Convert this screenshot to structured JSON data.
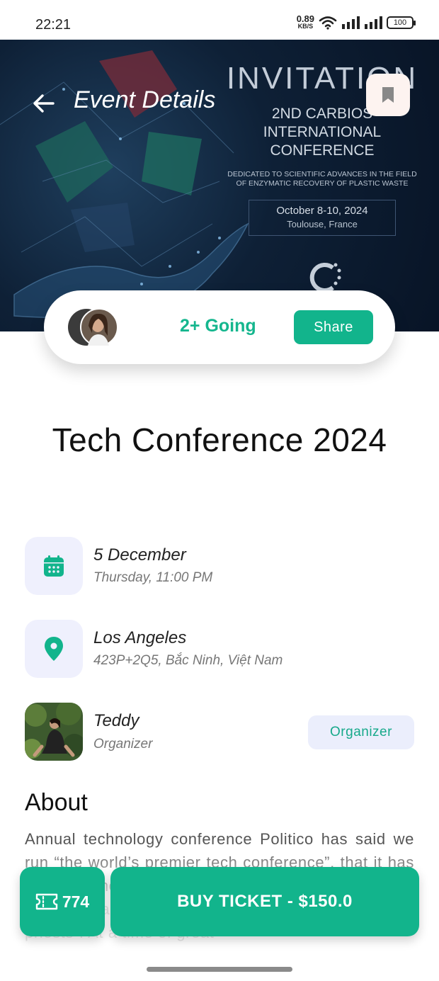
{
  "status_bar": {
    "time": "22:21",
    "net_speed": "0.89",
    "net_unit": "KB/S",
    "battery": "100"
  },
  "header": {
    "title": "Event Details",
    "back_icon": "arrow-left-icon",
    "bookmark_icon": "bookmark-icon"
  },
  "poster": {
    "title": "INVITATION",
    "line1": "2ND CARBIOS",
    "line2": "INTERNATIONAL",
    "line3": "CONFERENCE",
    "desc1": "DEDICATED TO SCIENTIFIC ADVANCES IN THE FIELD",
    "desc2": "OF ENZYMATIC RECOVERY OF PLASTIC WASTE",
    "date": "October 8-10, 2024",
    "place": "Toulouse, France"
  },
  "going": {
    "text": "2+ Going",
    "share_label": "Share"
  },
  "event": {
    "title": "Tech Conference 2024"
  },
  "date_info": {
    "primary": "5 December",
    "secondary": "Thursday, 11:00 PM",
    "icon": "calendar-icon"
  },
  "location_info": {
    "primary": "Los Angeles",
    "secondary": "423P+2Q5, Bắc Ninh, Việt Nam",
    "icon": "location-pin-icon"
  },
  "organizer": {
    "name": "Teddy",
    "role": "Organizer",
    "chip_label": "Organizer"
  },
  "about": {
    "heading": "About",
    "text": "Annual technology conference Politico has said we run “the world’s premier tech conference”, that it has become the tech world’s answer to the world’s professional gathering of the tech industry’s high priests”. At a time of great"
  },
  "footer": {
    "ticket_count": "774",
    "ticket_icon": "ticket-icon",
    "buy_label": "BUY TICKET - $150.0"
  },
  "colors": {
    "accent": "#12b48c",
    "icon_bg": "#eff0fd"
  }
}
